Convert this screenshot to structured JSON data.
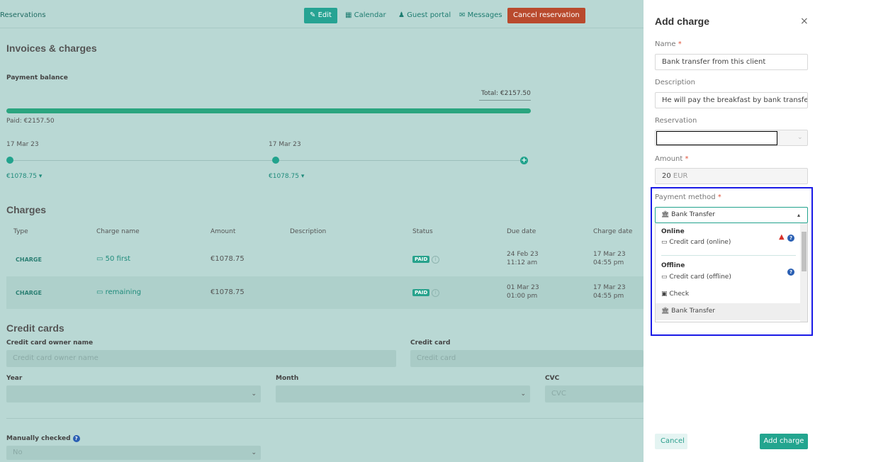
{
  "topbar": {
    "breadcrumb": "Reservations",
    "edit": "Edit",
    "calendar": "Calendar",
    "guest_portal": "Guest portal",
    "messages": "Messages",
    "cancel_reservation": "Cancel reservation"
  },
  "invoices": {
    "title": "Invoices & charges",
    "payment_balance": "Payment balance",
    "total": "Total: €2157.50",
    "paid": "Paid: €2157.50",
    "paid_fraction": 1.0,
    "timeline": [
      {
        "date": "17 Mar 23",
        "amount": "€1078.75"
      },
      {
        "date": "17 Mar 23",
        "amount": "€1078.75"
      }
    ]
  },
  "charges": {
    "title": "Charges",
    "headers": [
      "Type",
      "Charge name",
      "Amount",
      "Description",
      "Status",
      "Due date",
      "Charge date"
    ],
    "rows": [
      {
        "type": "CHARGE",
        "name": "50 first",
        "amount": "€1078.75",
        "status": "PAID",
        "due_date": "24 Feb 23",
        "due_time": "11:12 am",
        "charge_date": "17 Mar 23",
        "charge_time": "04:55 pm"
      },
      {
        "type": "CHARGE",
        "name": "remaining",
        "amount": "€1078.75",
        "status": "PAID",
        "due_date": "01 Mar 23",
        "due_time": "01:00 pm",
        "charge_date": "17 Mar 23",
        "charge_time": "04:55 pm"
      }
    ]
  },
  "credit_cards": {
    "title": "Credit cards",
    "owner_label": "Credit card owner name",
    "owner_placeholder": "Credit card owner name",
    "card_label": "Credit card",
    "card_placeholder": "Credit card",
    "year_label": "Year",
    "month_label": "Month",
    "cvc_label": "CVC",
    "cvc_placeholder": "CVC",
    "manually_checked_label": "Manually checked",
    "manually_checked_value": "No"
  },
  "panel": {
    "title": "Add charge",
    "close": "×",
    "name_label": "Name",
    "name_value": "Bank transfer from this client",
    "description_label": "Description",
    "description_value": "He will pay the breakfast by bank transfer",
    "reservation_label": "Reservation",
    "amount_label": "Amount",
    "amount_value": "20",
    "amount_currency": "EUR",
    "payment_method_label": "Payment method",
    "payment_method_selected": "Bank Transfer",
    "required_mark": "*",
    "dropdown": {
      "online_group": "Online",
      "online_items": [
        "Credit card (online)"
      ],
      "offline_group": "Offline",
      "offline_items": [
        "Credit card (offline)",
        "Check",
        "Bank Transfer"
      ]
    },
    "cancel_button": "Cancel",
    "add_button": "Add charge"
  },
  "colors": {
    "accent": "#22a38d",
    "danger": "#b94a2d",
    "highlight": "#1a1ae6"
  }
}
